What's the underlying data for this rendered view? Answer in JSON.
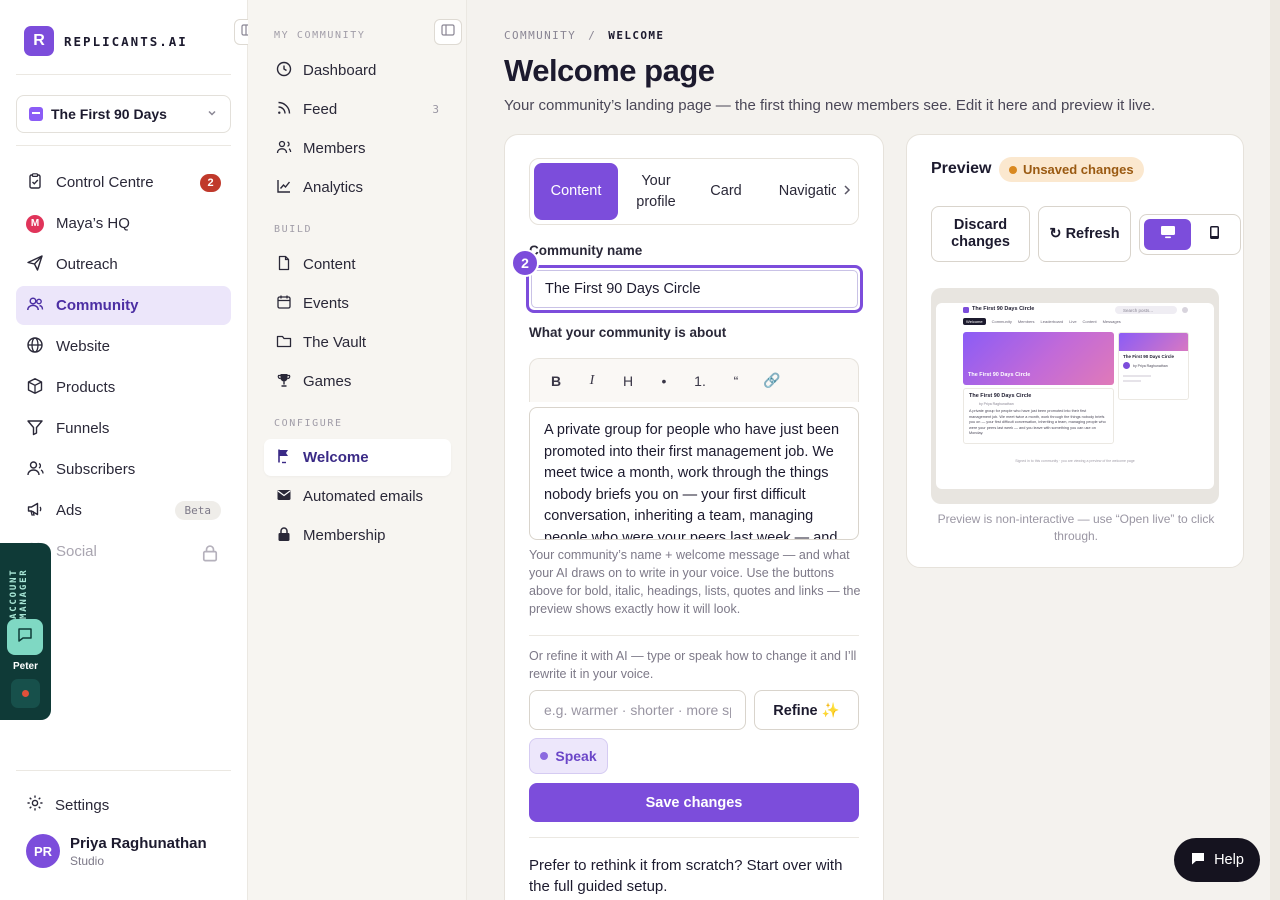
{
  "brand": {
    "logo_letter": "R",
    "name": "REPLICANTS.AI"
  },
  "space": {
    "name": "The First 90 Days"
  },
  "nav": [
    {
      "label": "Control Centre",
      "icon": "clipboard-icon",
      "badge": "2"
    },
    {
      "label": "Maya’s HQ",
      "icon": "maya-icon",
      "logo_letter": "M"
    },
    {
      "label": "Outreach",
      "icon": "send-icon"
    },
    {
      "label": "Community",
      "icon": "users-icon",
      "active": true
    },
    {
      "label": "Website",
      "icon": "globe-icon"
    },
    {
      "label": "Products",
      "icon": "box-icon"
    },
    {
      "label": "Funnels",
      "icon": "funnel-icon"
    },
    {
      "label": "Subscribers",
      "icon": "user-icon"
    },
    {
      "label": "Ads",
      "icon": "megaphone-icon",
      "badge": "Beta"
    },
    {
      "label": "Social",
      "icon": "heart-icon",
      "locked": true
    }
  ],
  "settings": {
    "label": "Settings"
  },
  "user": {
    "initials": "PR",
    "name": "Priya Raghunathan",
    "plan": "Studio"
  },
  "account_manager": {
    "label": "ACCOUNT MANAGER",
    "name": "Peter"
  },
  "subnav": {
    "sections": [
      "MY COMMUNITY",
      "BUILD",
      "CONFIGURE"
    ],
    "my_community": [
      {
        "label": "Dashboard",
        "icon": "clock-icon"
      },
      {
        "label": "Feed",
        "icon": "rss-icon",
        "count": "3"
      },
      {
        "label": "Members",
        "icon": "members-icon"
      },
      {
        "label": "Analytics",
        "icon": "chart-icon"
      }
    ],
    "build": [
      {
        "label": "Content",
        "icon": "document-icon"
      },
      {
        "label": "Events",
        "icon": "calendar-icon"
      },
      {
        "label": "The Vault",
        "icon": "folder-icon"
      },
      {
        "label": "Games",
        "icon": "trophy-icon"
      }
    ],
    "configure": [
      {
        "label": "Welcome",
        "icon": "flag-icon",
        "active": true
      },
      {
        "label": "Automated emails",
        "icon": "mail-icon"
      },
      {
        "label": "Membership",
        "icon": "lock-icon"
      }
    ]
  },
  "breadcrumb": {
    "parent": "COMMUNITY",
    "separator": "/",
    "current": "WELCOME"
  },
  "page": {
    "title": "Welcome page",
    "subtitle": "Your community’s landing page — the first thing new members see. Edit it here and preview it live."
  },
  "editor": {
    "tabs": [
      "Content",
      "Your profile",
      "Card",
      "Navigation"
    ],
    "active_tab": "Content",
    "step_number": "2",
    "name_label": "Community name",
    "name_value": "The First 90 Days Circle",
    "about_label": "What your community is about",
    "toolbar": [
      "B",
      "I",
      "H",
      "•",
      "1.",
      "“",
      "🔗"
    ],
    "about_text": "A private group for people who have just been promoted into their first management job. We meet twice a month, work through the things nobody briefs you on — your first difficult conversation, inheriting a team, managing people who were your peers last week — and you leave with something you can use on Monday.",
    "help_text": "Your community’s name + welcome message — and what your AI draws on to write in your voice. Use the buttons above for bold, italic, headings, lists, quotes and links — the preview shows exactly how it will look.",
    "refine_hint": "Or refine it with AI — type or speak how to change it and I’ll rewrite it in your voice.",
    "refine_placeholder": "e.g. warmer · shorter · more specific",
    "refine_button": "Refine ✨",
    "speak_button": "Speak",
    "save_button": "Save changes",
    "restart_text": "Prefer to rethink it from scratch? Start over with the full guided setup."
  },
  "preview": {
    "title": "Preview",
    "status": "Unsaved changes",
    "discard_button": "Discard changes",
    "refresh_button": "↻ Refresh",
    "device_options": [
      "desktop-icon",
      "mobile-icon"
    ],
    "active_device": "desktop",
    "note": "Preview is non-interactive — use “Open live” to click through.",
    "mini": {
      "site_name": "The First 90 Days Circle",
      "search": "Search posts...",
      "nav": [
        "Welcome",
        "Community",
        "Members",
        "Leaderboard",
        "Live",
        "Content",
        "Messages"
      ],
      "hero_title": "The First 90 Days Circle",
      "card_title": "The First 90 Days Circle",
      "card_byline": "by Priya Raghunathan",
      "card_body": "A private group for people who have just been promoted into their first management job. We meet twice a month, work through the things nobody briefs you on — your first difficult conversation, inheriting a team, managing people who were your peers last week — and you leave with something you can use on Monday.",
      "side_title": "The First 90 Days Circle",
      "side_byline": "by Priya Raghunathan",
      "footer": "Signed in to this community · you are viewing a preview of the welcome page"
    }
  },
  "help_fab": {
    "label": "Help"
  },
  "colors": {
    "accent": "#7c4ddb",
    "badge_red": "#c0392b",
    "warning": "#d9881f",
    "dark": "#15131f"
  }
}
